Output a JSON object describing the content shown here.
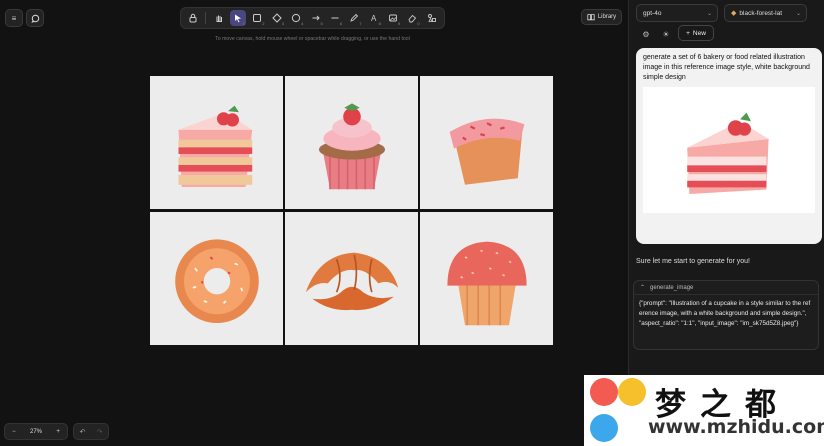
{
  "toolbar": {
    "hint": "To move canvas, hold mouse wheel or spacebar while dragging, or use the hand tool",
    "library_label": "Library",
    "tools": [
      {
        "name": "lock",
        "key": ""
      },
      {
        "name": "hand",
        "key": ""
      },
      {
        "name": "select",
        "key": "1"
      },
      {
        "name": "rectangle",
        "key": "2"
      },
      {
        "name": "diamond",
        "key": "3"
      },
      {
        "name": "ellipse",
        "key": "4"
      },
      {
        "name": "arrow",
        "key": "5"
      },
      {
        "name": "line",
        "key": "6"
      },
      {
        "name": "draw",
        "key": "7"
      },
      {
        "name": "text",
        "key": "8"
      },
      {
        "name": "image",
        "key": "9"
      },
      {
        "name": "eraser",
        "key": "0"
      },
      {
        "name": "more",
        "key": ""
      }
    ]
  },
  "zoom": {
    "minus": "−",
    "value": "27%",
    "plus": "+"
  },
  "grid_images": [
    {
      "name": "strawberry-cake-slice"
    },
    {
      "name": "strawberry-cupcake"
    },
    {
      "name": "pound-cake"
    },
    {
      "name": "donut"
    },
    {
      "name": "croissant"
    },
    {
      "name": "muffin"
    }
  ],
  "panel": {
    "model_select": "gpt-4o",
    "image_model_select": "black-forest-lat",
    "new_label": "New",
    "user_message": "generate a set of 6 bakery or food related illustration image in this reference image style, white background simple design",
    "assistant_reply": "Sure let me start to generate for you!",
    "tool_call": {
      "title": "generate_image",
      "body": "{\"prompt\": \"Illustration of a cupcake in a style similar to the reference image, with a white background and simple design.\", \"aspect_ratio\": \"1:1\", \"input_image\": \"im_sk75d5Z8.jpeg\"}"
    }
  },
  "watermark": {
    "text": "梦之都",
    "url": "www.mzhidu.com"
  },
  "colors": {
    "accent": "#4a4780",
    "strawberry": "#e0424a",
    "cream": "#f7b6bf",
    "pastry": "#e6905a"
  }
}
